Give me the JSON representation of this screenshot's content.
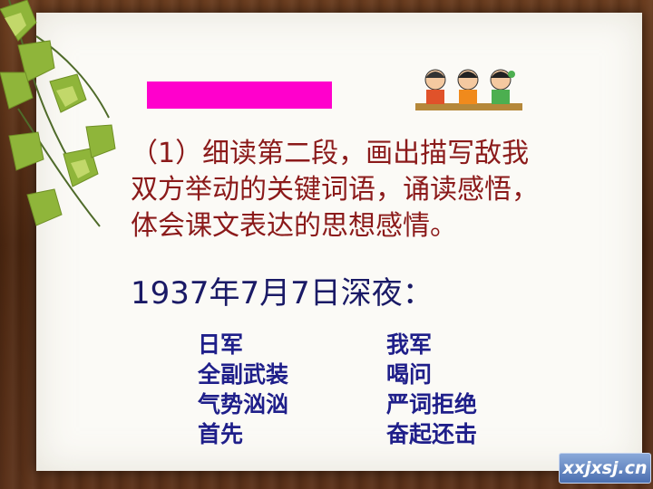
{
  "instruction": {
    "line1": "（1）细读第二段，画出描写敌我",
    "line2": "双方举动的关键词语，诵读感悟，",
    "line3": "体会课文表达的思想感情。"
  },
  "date_line": "1937年7月7日深夜：",
  "japanese_side": [
    "日军",
    "全副武装",
    "气势汹汹",
    "首先"
  ],
  "our_side": [
    "我军",
    "喝问",
    "严词拒绝",
    "奋起还击"
  ],
  "logo_text": "xxjxsj.cn",
  "colors": {
    "accent_bar": "#ff00cc",
    "instruction_text": "#8b1a1a",
    "date_text": "#1a1a66",
    "list_text": "#1f1f8a",
    "background_wood": "#5c321a",
    "card": "#fbfaf6"
  },
  "icons": [
    "ivy-leaves-icon",
    "three-children-icon"
  ]
}
